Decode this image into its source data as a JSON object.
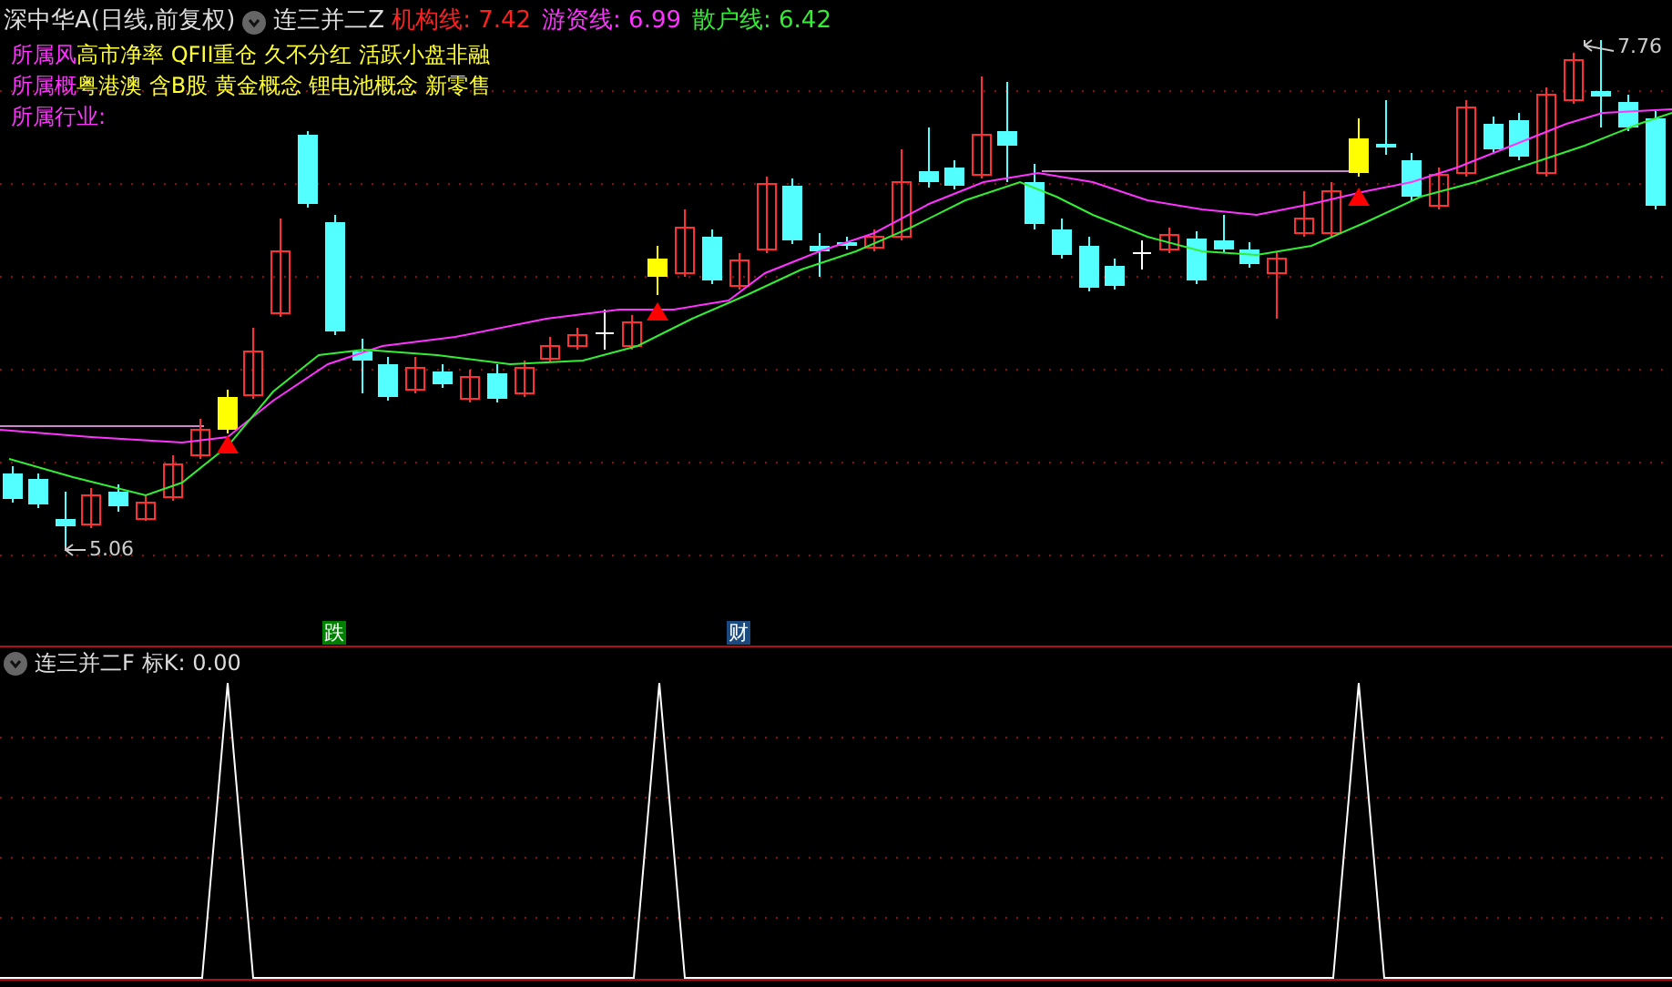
{
  "header": {
    "title": "深中华A(日线,前复权)",
    "indicator": "连三并二Z",
    "lines": [
      {
        "text": "机构线: 7.42",
        "color": "#ff2020"
      },
      {
        "text": "游资线: 6.99",
        "color": "#ff33ff"
      },
      {
        "text": "散户线: 6.42",
        "color": "#33ee33"
      }
    ]
  },
  "info": [
    {
      "label": "所属风",
      "value": "高市净率 QFII重仓 久不分红 活跃小盘非融"
    },
    {
      "label": "所属概",
      "value": "粤港澳 含B股 黄金概念 锂电池概念 新零售"
    },
    {
      "label": "所属行业:"
    }
  ],
  "price_labels": {
    "high": "7.76",
    "low": "5.06"
  },
  "events": [
    {
      "text": "跌",
      "color": "#008000"
    },
    {
      "text": "财",
      "color": "#1a4a80"
    }
  ],
  "lower_panel": {
    "indicator": "连三并二F",
    "reading": "标K: 0.00"
  }
}
